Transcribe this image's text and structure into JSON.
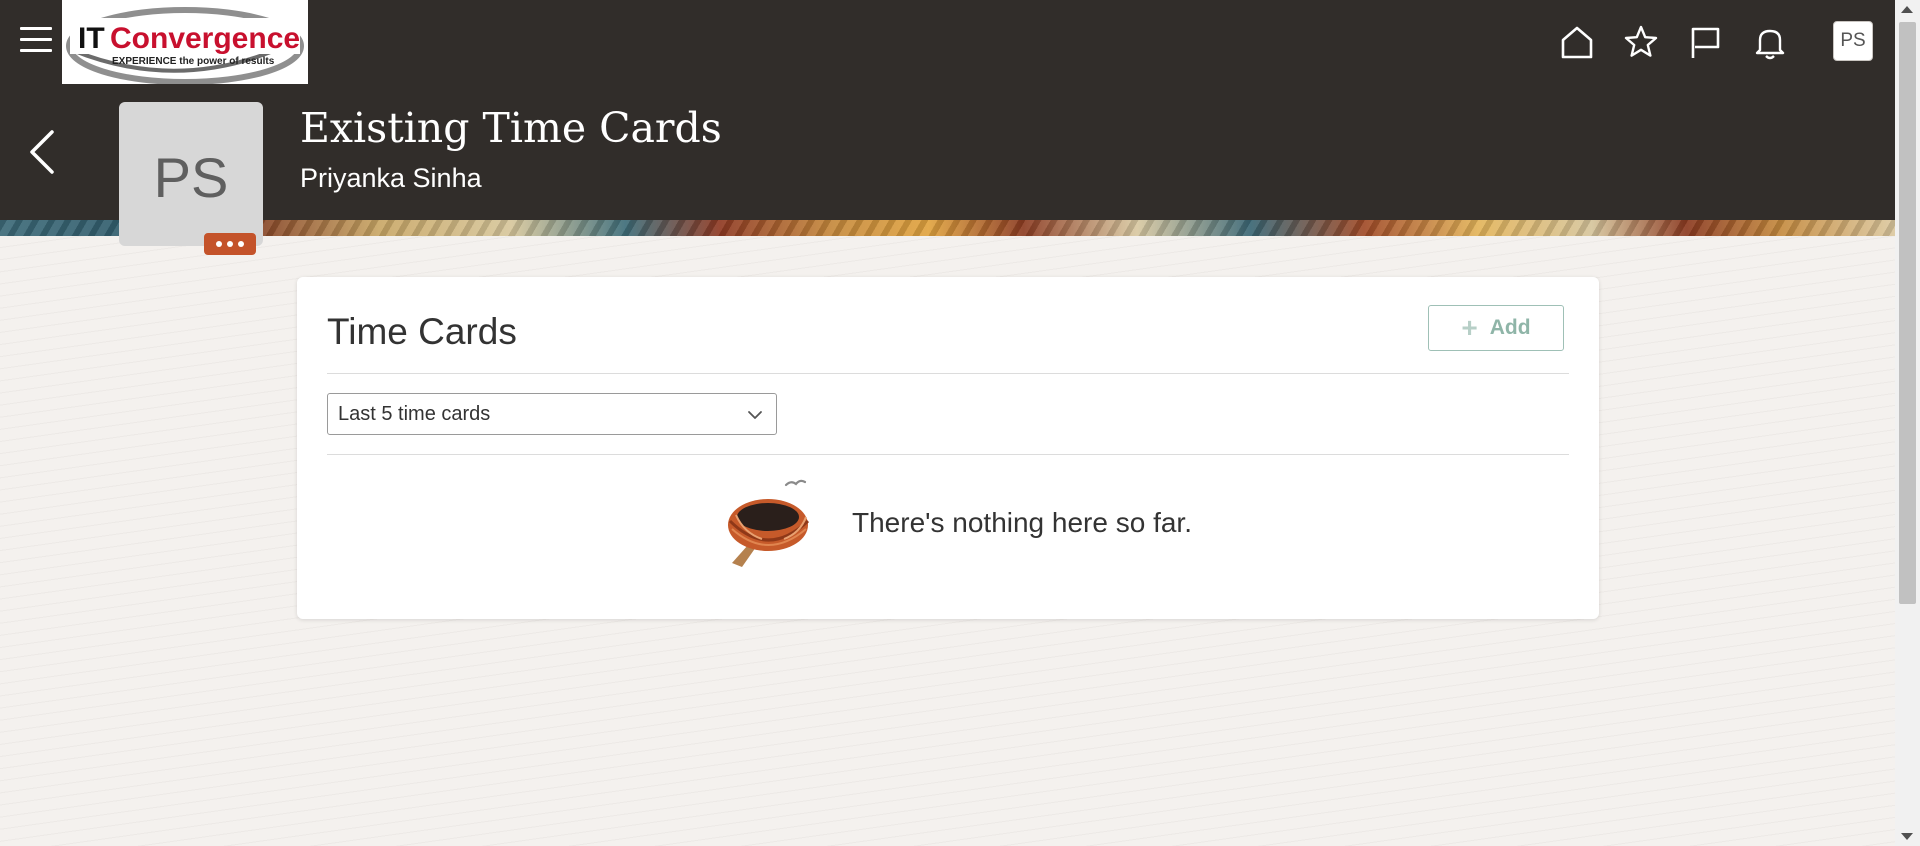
{
  "topbar": {
    "logo_alt": "ITConvergence",
    "logo_brand_it": "IT",
    "logo_brand_rest": "Convergence",
    "logo_tagline": "EXPERIENCE the power of results",
    "user_initials": "PS"
  },
  "header": {
    "title": "Existing Time Cards",
    "subtitle": "Priyanka Sinha",
    "profile_initials": "PS"
  },
  "card": {
    "title": "Time Cards",
    "add_label": "Add",
    "filter_value": "Last 5 time cards",
    "empty_message": "There's nothing here so far."
  },
  "colors": {
    "header_bg": "#312d2a",
    "accent": "#c4532a",
    "logo_red": "#c8102e"
  }
}
